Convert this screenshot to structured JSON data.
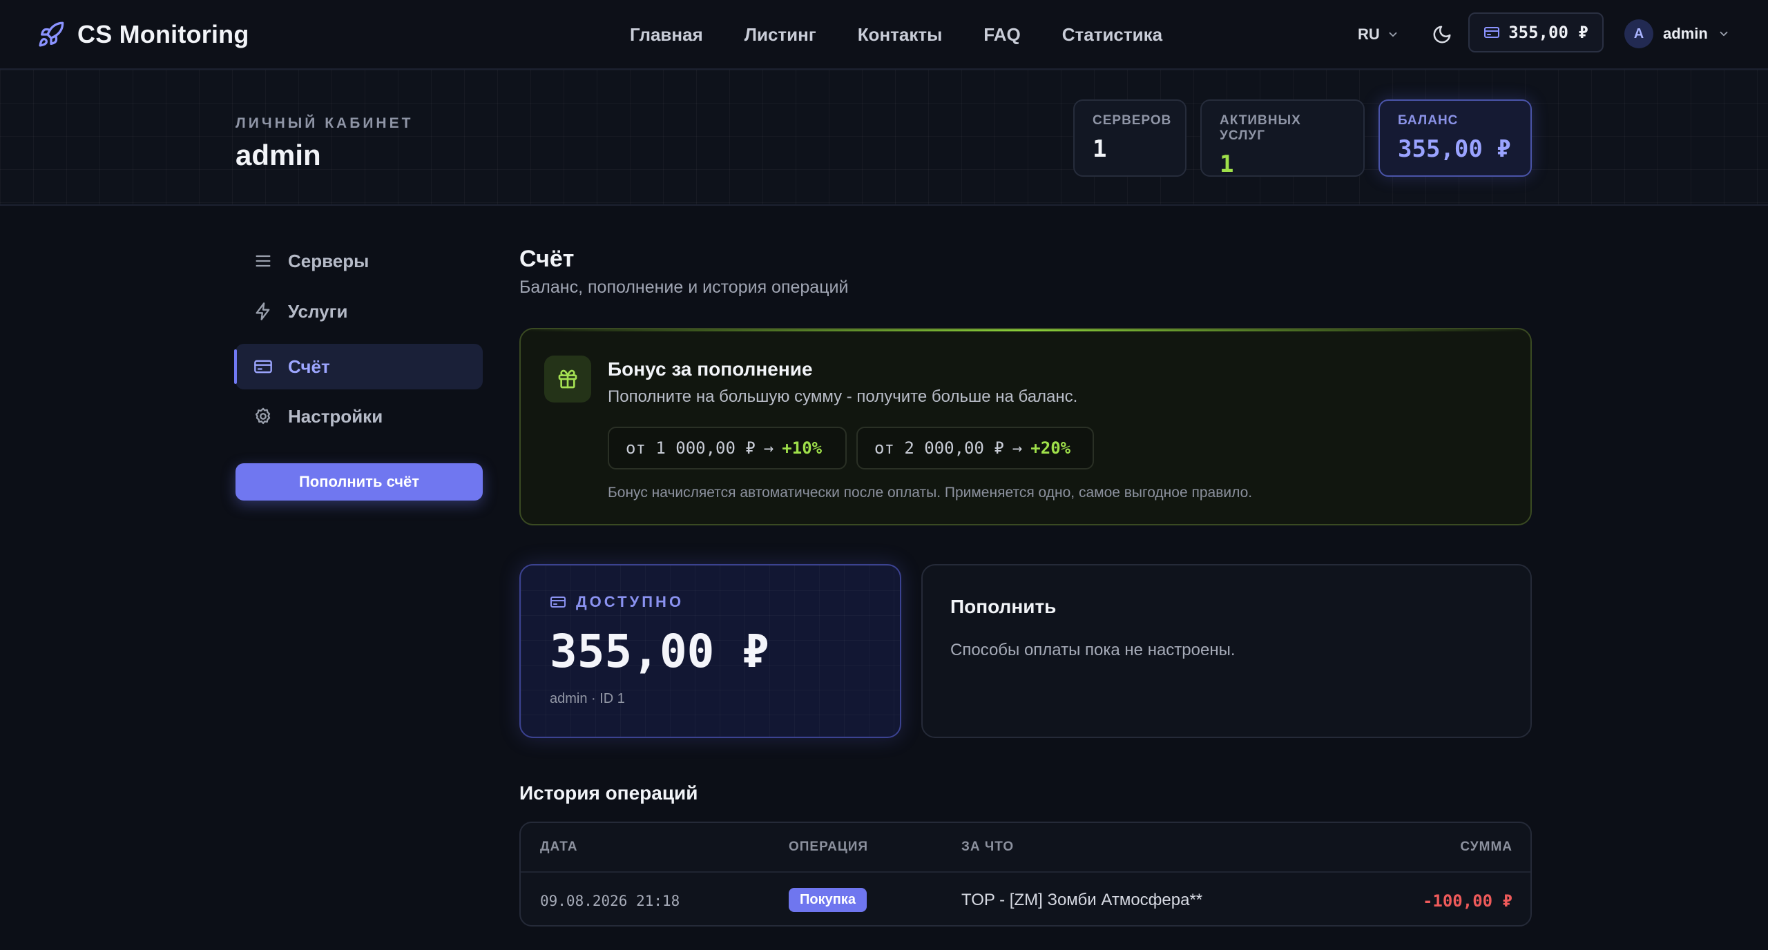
{
  "brand": {
    "name": "CS Monitoring"
  },
  "nav": {
    "links": [
      "Главная",
      "Листинг",
      "Контакты",
      "FAQ",
      "Статистика"
    ],
    "lang": "RU",
    "balance": "355,00 ₽",
    "user_initial": "A",
    "user_name": "admin"
  },
  "profile": {
    "kicker": "ЛИЧНЫЙ КАБИНЕТ",
    "name": "admin",
    "stats": [
      {
        "label": "СЕРВЕРОВ",
        "value": "1",
        "color": "#f2f4f8"
      },
      {
        "label": "АКТИВНЫХ УСЛУГ",
        "value": "1",
        "color": "#9fe04a"
      },
      {
        "label": "БАЛАНС",
        "value": "355,00 ₽",
        "color": "#9aa3ff"
      }
    ]
  },
  "sidebar": {
    "items": [
      {
        "label": "Серверы",
        "icon": "list-icon"
      },
      {
        "label": "Услуги",
        "icon": "bolt-icon"
      },
      {
        "label": "Счёт",
        "icon": "card-icon",
        "active": true
      },
      {
        "label": "Настройки",
        "icon": "gear-icon"
      }
    ],
    "topup_button": "Пополнить счёт"
  },
  "main": {
    "title": "Счёт",
    "subtitle": "Баланс, пополнение и история операций",
    "bonus": {
      "title": "Бонус за пополнение",
      "description": "Пополните на большую сумму - получите больше на баланс.",
      "tiers": [
        {
          "threshold": "от 1 000,00 ₽",
          "arrow": "→",
          "percent": "+10%"
        },
        {
          "threshold": "от 2 000,00 ₽",
          "arrow": "→",
          "percent": "+20%"
        }
      ],
      "note": "Бонус начисляется автоматически после оплаты. Применяется одно, самое выгодное правило."
    },
    "available": {
      "label": "ДОСТУПНО",
      "amount": "355,00 ₽",
      "meta": "admin · ID 1"
    },
    "topup": {
      "title": "Пополнить",
      "description": "Способы оплаты пока не настроены."
    },
    "history": {
      "title": "История операций",
      "columns": {
        "date": "ДАТА",
        "operation": "ОПЕРАЦИЯ",
        "for": "ЗА ЧТО",
        "sum": "СУММА"
      },
      "rows": [
        {
          "date": "09.08.2026 21:18",
          "operation": "Покупка",
          "for": "TOP - [ZM] Зомби Атмосфера**",
          "sum": "-100,00 ₽"
        }
      ]
    }
  },
  "colors": {
    "accent": "#7077f0",
    "positive": "#9fe04a",
    "negative": "#ee5a5a",
    "background": "#0c0f17"
  }
}
